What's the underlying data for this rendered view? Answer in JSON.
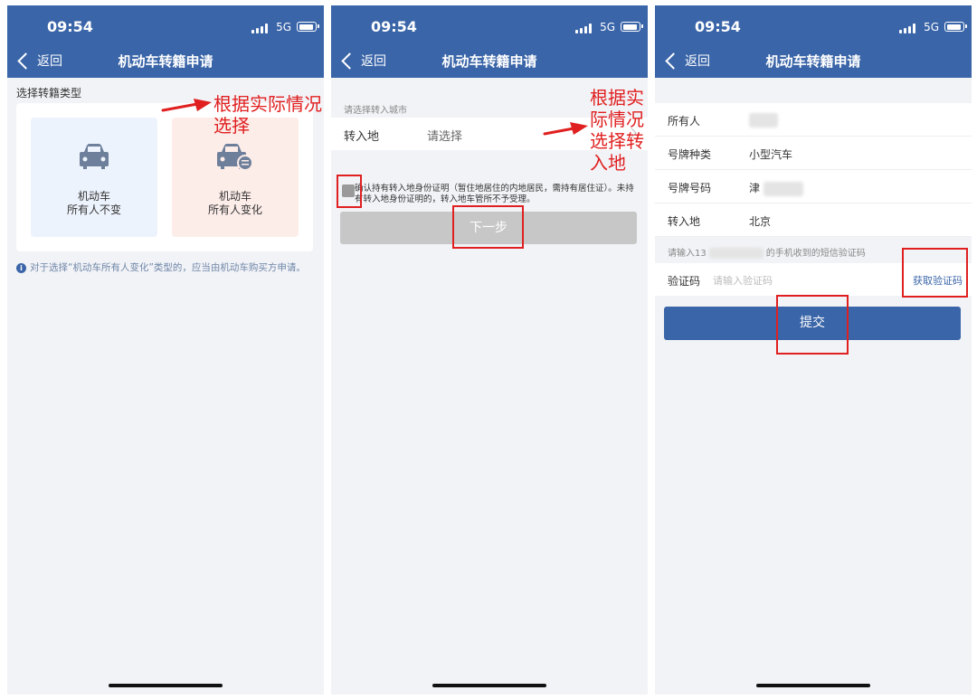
{
  "status": {
    "time": "09:54",
    "network": "5G"
  },
  "nav": {
    "back_label": "返回",
    "title": "机动车转籍申请"
  },
  "screen1": {
    "section_title": "选择转籍类型",
    "cards": [
      {
        "line1": "机动车",
        "line2": "所有人不变",
        "icon": "car-icon"
      },
      {
        "line1": "机动车",
        "line2": "所有人变化",
        "icon": "car-transfer-icon"
      }
    ],
    "note": "对于选择“机动车所有人变化”类型的，应当由机动车购买方申请。",
    "annotation": "根据实际情况\n选择"
  },
  "screen2": {
    "city_label": "请选择转入城市",
    "field_label": "转入地",
    "field_placeholder": "请选择",
    "agree_text": "确认持有转入地身份证明（暂住地居住的内地居民，需持有居住证）。未持有转入地身份证明的，转入地车管所不予受理。",
    "next_button": "下一步",
    "annotation": "根据实\n际情况\n选择转\n入地"
  },
  "screen3": {
    "fields": [
      {
        "label": "所有人",
        "value": ""
      },
      {
        "label": "号牌种类",
        "value": "小型汽车"
      },
      {
        "label": "号牌号码",
        "value": "津"
      },
      {
        "label": "转入地",
        "value": "北京"
      }
    ],
    "sms_prefix": "请输入13",
    "sms_suffix": "的手机收到的短信验证码",
    "code_label": "验证码",
    "code_placeholder": "请输入验证码",
    "get_code": "获取验证码",
    "submit_button": "提交"
  },
  "colors": {
    "header": "#3a65a8",
    "annotation": "#e02020",
    "button_disabled": "#c7c7c7"
  }
}
